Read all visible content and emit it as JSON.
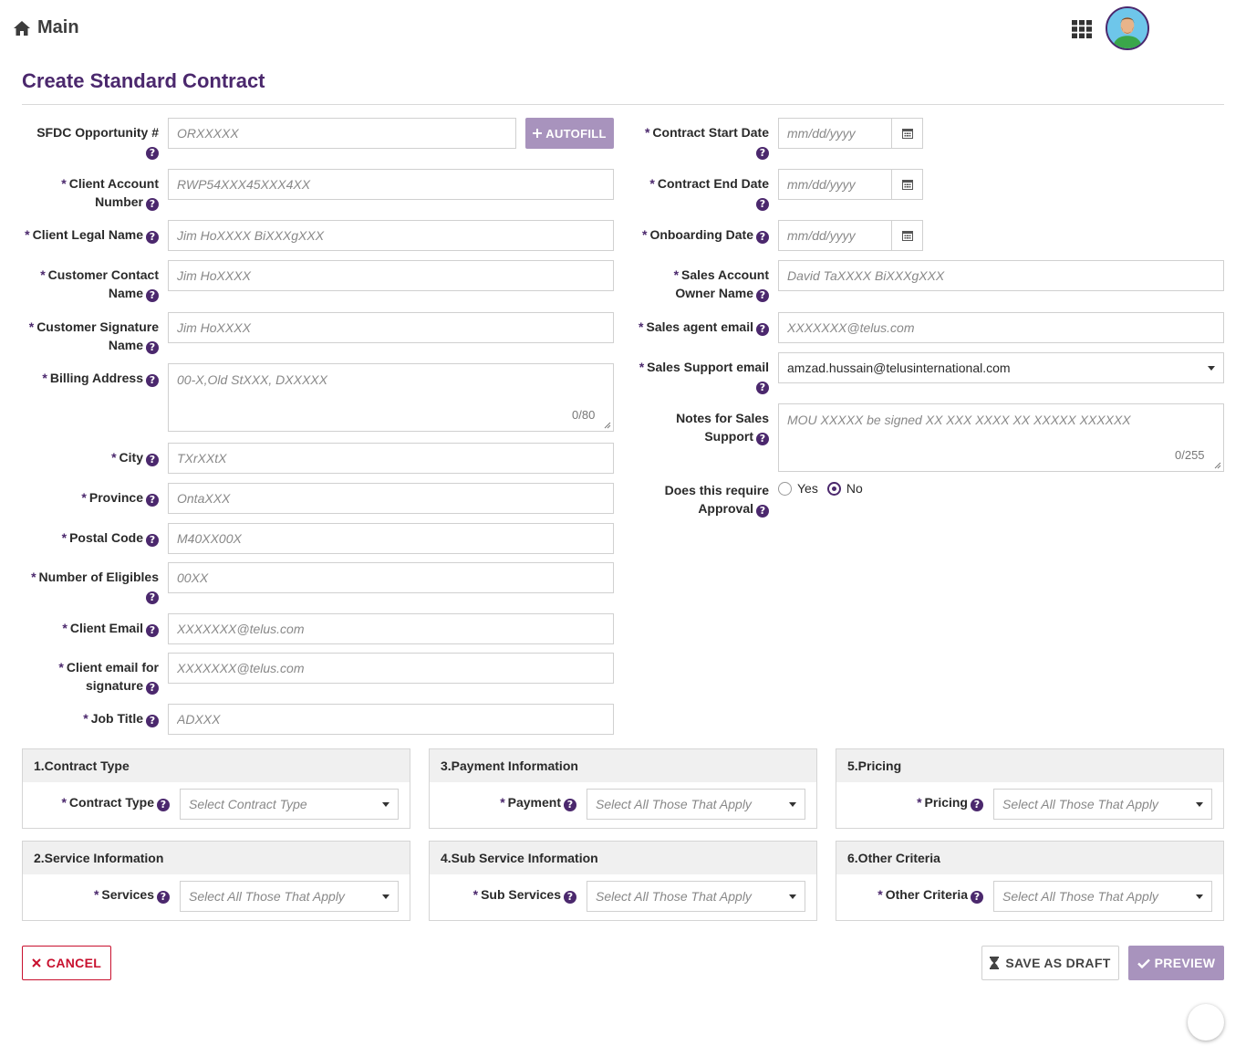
{
  "header": {
    "home_label": "Main"
  },
  "page": {
    "title": "Create Standard Contract"
  },
  "left_form": {
    "sfdc_label": "SFDC Opportunity #",
    "sfdc_placeholder": "ORXXXXX",
    "autofill_label": "AUTOFILL",
    "client_account_label_1": "Client Account",
    "client_account_label_2": "Number",
    "client_account_placeholder": "RWP54XXX45XXX4XX",
    "client_legal_label": "Client Legal Name",
    "client_legal_placeholder": "Jim HoXXXX BiXXXgXXX",
    "customer_contact_label_1": "Customer Contact",
    "customer_contact_label_2": "Name",
    "customer_contact_placeholder": "Jim HoXXXX",
    "customer_signature_label_1": "Customer Signature",
    "customer_signature_label_2": "Name",
    "customer_signature_placeholder": "Jim HoXXXX",
    "billing_label": "Billing Address",
    "billing_placeholder": "00-X,Old StXXX, DXXXXX",
    "billing_counter": "0/80",
    "city_label": "City",
    "city_placeholder": "TXrXXtX",
    "province_label": "Province",
    "province_placeholder": "OntaXXX",
    "postal_label": "Postal Code",
    "postal_placeholder": "M40XX00X",
    "eligibles_label": "Number of Eligibles",
    "eligibles_placeholder": "00XX",
    "client_email_label": "Client Email",
    "client_email_placeholder": "XXXXXXX@telus.com",
    "client_email_sig_label_1": "Client email for",
    "client_email_sig_label_2": "signature",
    "client_email_sig_placeholder": "XXXXXXX@telus.com",
    "job_title_label": "Job Title",
    "job_title_placeholder": "ADXXX"
  },
  "right_form": {
    "start_date_label": "Contract Start Date",
    "end_date_label": "Contract End Date",
    "onboarding_label": "Onboarding Date",
    "date_placeholder": "mm/dd/yyyy",
    "sales_owner_label_1": "Sales Account",
    "sales_owner_label_2": "Owner Name",
    "sales_owner_placeholder": "David TaXXXX BiXXXgXXX",
    "sales_agent_label": "Sales agent email",
    "sales_agent_placeholder": "XXXXXXX@telus.com",
    "sales_support_label": "Sales Support email",
    "sales_support_value": "amzad.hussain@telusinternational.com",
    "notes_label_1": "Notes for Sales",
    "notes_label_2": "Support",
    "notes_placeholder": "MOU XXXXX be signed XX XXX XXXX XX XXXXX XXXXXX",
    "notes_counter": "0/255",
    "approval_label_1": "Does this require",
    "approval_label_2": "Approval",
    "approval_yes": "Yes",
    "approval_no": "No",
    "approval_selected": "No"
  },
  "panels": {
    "contract_type": {
      "title": "1.Contract Type",
      "label": "Contract Type",
      "placeholder": "Select Contract Type"
    },
    "service_info": {
      "title": "2.Service Information",
      "label": "Services",
      "placeholder": "Select All Those That Apply"
    },
    "payment_info": {
      "title": "3.Payment Information",
      "label": "Payment",
      "placeholder": "Select All Those That Apply"
    },
    "sub_service": {
      "title": "4.Sub Service Information",
      "label": "Sub Services",
      "placeholder": "Select All Those That Apply"
    },
    "pricing": {
      "title": "5.Pricing",
      "label": "Pricing",
      "placeholder": "Select All Those That Apply"
    },
    "other_criteria": {
      "title": "6.Other Criteria",
      "label": "Other Criteria",
      "placeholder": "Select All Those That Apply"
    }
  },
  "actions": {
    "cancel_label": "CANCEL",
    "draft_label": "SAVE AS DRAFT",
    "preview_label": "PREVIEW"
  },
  "colors": {
    "brand_purple": "#4b286d",
    "disabled_purple": "#a893bd",
    "cancel_red": "#c8102e"
  },
  "icons": {
    "home": "home-icon",
    "apps": "apps-grid-icon",
    "calendar": "calendar-icon",
    "help": "help-icon",
    "plus": "plus-icon",
    "close": "close-icon",
    "hourglass": "hourglass-icon",
    "check": "check-icon"
  }
}
